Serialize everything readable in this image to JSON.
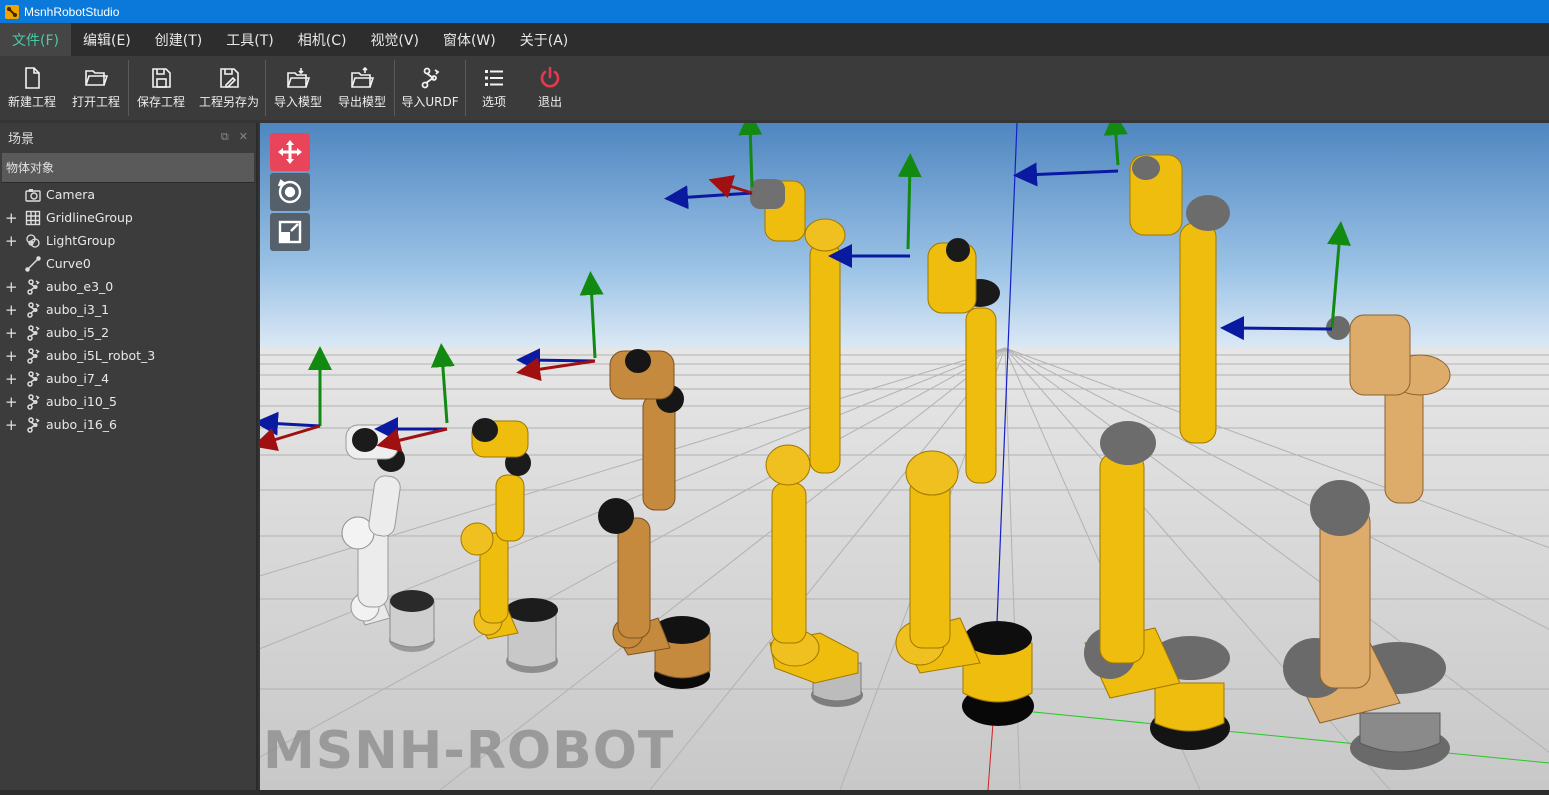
{
  "window": {
    "title": "MsnhRobotStudio"
  },
  "menu": [
    {
      "label": "文件(F)",
      "active": true
    },
    {
      "label": "编辑(E)"
    },
    {
      "label": "创建(T)"
    },
    {
      "label": "工具(T)"
    },
    {
      "label": "相机(C)"
    },
    {
      "label": "视觉(V)"
    },
    {
      "label": "窗体(W)"
    },
    {
      "label": "关于(A)"
    }
  ],
  "toolbar": {
    "new_project": "新建工程",
    "open_project": "打开工程",
    "save_project": "保存工程",
    "save_project_as": "工程另存为",
    "import_model": "导入模型",
    "export_model": "导出模型",
    "import_urdf": "导入URDF",
    "options": "选项",
    "exit": "退出"
  },
  "scene_panel": {
    "title": "场景",
    "tree_header": "物体对象",
    "items": [
      {
        "label": "Camera",
        "icon": "camera-icon",
        "expandable": false
      },
      {
        "label": "GridlineGroup",
        "icon": "grid-icon",
        "expandable": true
      },
      {
        "label": "LightGroup",
        "icon": "light-icon",
        "expandable": true
      },
      {
        "label": "Curve0",
        "icon": "curve-icon",
        "expandable": false
      },
      {
        "label": "aubo_e3_0",
        "icon": "robot-icon",
        "expandable": true
      },
      {
        "label": "aubo_i3_1",
        "icon": "robot-icon",
        "expandable": true
      },
      {
        "label": "aubo_i5_2",
        "icon": "robot-icon",
        "expandable": true
      },
      {
        "label": "aubo_i5L_robot_3",
        "icon": "robot-icon",
        "expandable": true
      },
      {
        "label": "aubo_i7_4",
        "icon": "robot-icon",
        "expandable": true
      },
      {
        "label": "aubo_i10_5",
        "icon": "robot-icon",
        "expandable": true
      },
      {
        "label": "aubo_i16_6",
        "icon": "robot-icon",
        "expandable": true
      }
    ]
  },
  "viewport": {
    "watermark": "MSNH-ROBOT",
    "tools": [
      "move-gizmo-icon",
      "rotate-gizmo-icon",
      "scale-gizmo-icon"
    ]
  },
  "colors": {
    "titlebar": "#0b79d9",
    "menu_active_text": "#4dc9a7",
    "exit_icon": "#e8384f",
    "move_tool": "#e8445a",
    "robot_white": "#e6e6e6",
    "robot_yellow": "#eebd0e",
    "robot_bronze": "#c58a3e",
    "robot_tan": "#ddac6a"
  }
}
